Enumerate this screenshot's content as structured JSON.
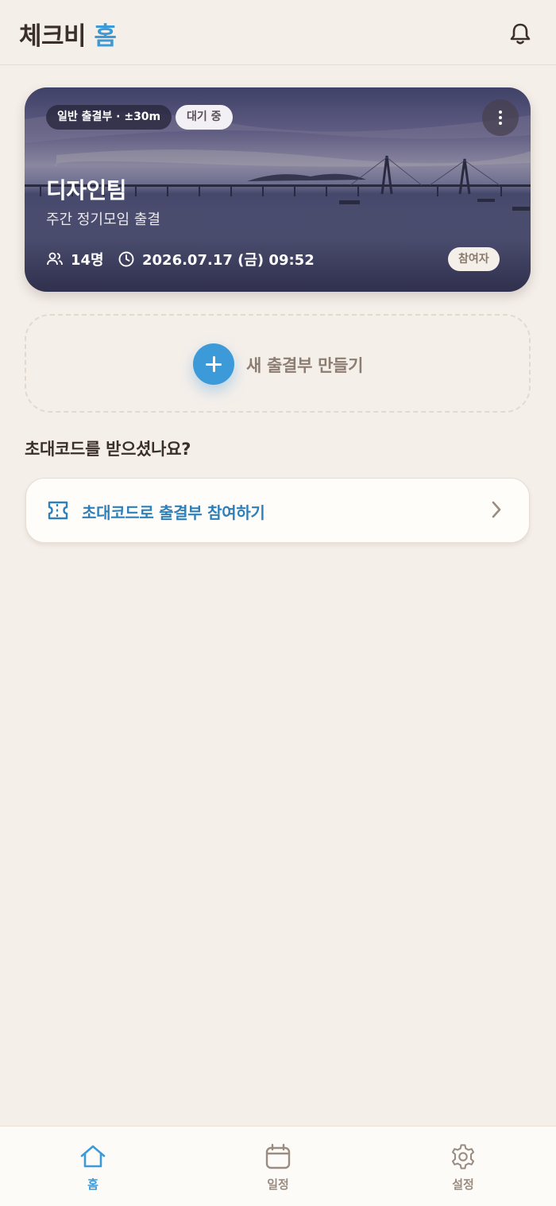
{
  "header": {
    "title_main": "체크비",
    "title_accent": "홈",
    "notification_icon": "bell-icon"
  },
  "card": {
    "type_label": "일반 출결부 · ±30m",
    "status_label": "대기 중",
    "title": "디자인팀",
    "subtitle": "주간 정기모임 출결",
    "members": "14명",
    "datetime": "2026.07.17 (금) 09:52",
    "role": "참여자",
    "more_icon": "more-vertical-icon",
    "background": "bridge-sea-photo"
  },
  "create": {
    "label": "새 출결부 만들기",
    "icon": "plus-icon"
  },
  "invite": {
    "section_title": "초대코드를 받으셨나요?",
    "join_label": "초대코드로 출결부 참여하기",
    "icon": "ticket-icon",
    "chevron": "chevron-right-icon"
  },
  "nav": {
    "home": "홈",
    "schedule": "일정",
    "settings": "설정"
  },
  "colors": {
    "accent": "#3d9ad9",
    "background": "#f5efea",
    "join_text": "#2f7fb8"
  }
}
